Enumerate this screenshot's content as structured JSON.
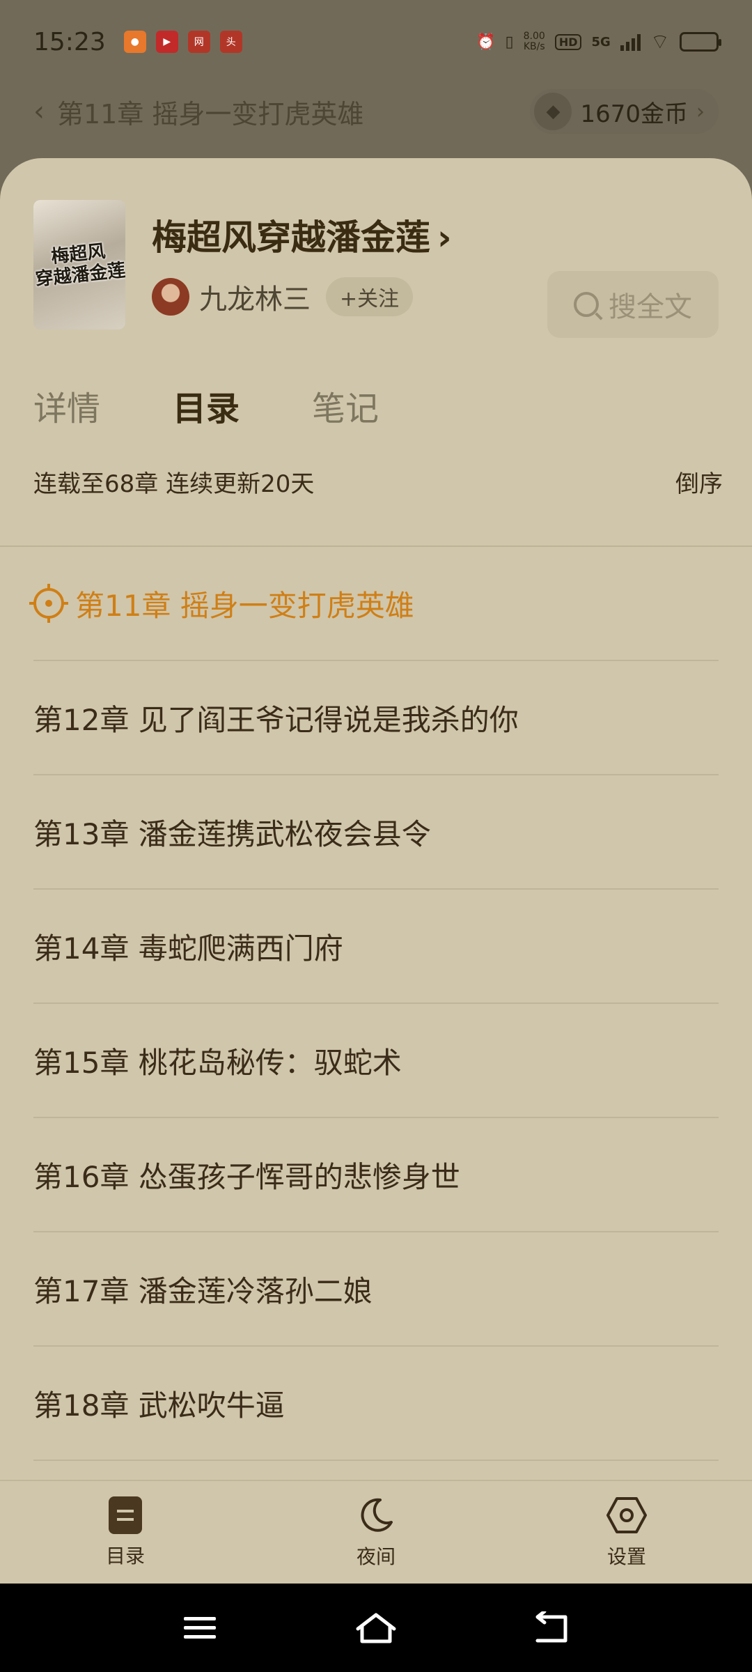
{
  "status_bar": {
    "time": "15:23",
    "notification_icons": [
      "app-icon-orange",
      "app-icon-red-play",
      "app-icon-netease",
      "app-icon-toutiao"
    ],
    "network_speed_value": "8.00",
    "network_speed_unit": "KB/s",
    "hd_label": "HD",
    "network_type": "5G",
    "battery_color": "#e3b22a"
  },
  "reader_header": {
    "chapter_title": "第11章 摇身一变打虎英雄",
    "coins": "1670金币"
  },
  "book": {
    "cover_text": "梅超风穿越潘金莲",
    "title": "梅超风穿越潘金莲",
    "author": "九龙林三",
    "follow_label": "+关注",
    "search_label": "搜全文"
  },
  "tabs": [
    {
      "label": "详情",
      "active": false
    },
    {
      "label": "目录",
      "active": true
    },
    {
      "label": "笔记",
      "active": false
    }
  ],
  "catalog": {
    "summary": "连载至68章 连续更新20天",
    "sort_label": "倒序",
    "accent_color": "#cf7f16",
    "chapters": [
      {
        "title": "第11章 摇身一变打虎英雄",
        "current": true
      },
      {
        "title": "第12章 见了阎王爷记得说是我杀的你",
        "current": false
      },
      {
        "title": "第13章 潘金莲携武松夜会县令",
        "current": false
      },
      {
        "title": "第14章 毒蛇爬满西门府",
        "current": false
      },
      {
        "title": "第15章 桃花岛秘传：驭蛇术",
        "current": false
      },
      {
        "title": "第16章 怂蛋孩子恽哥的悲惨身世",
        "current": false
      },
      {
        "title": "第17章 潘金莲冷落孙二娘",
        "current": false
      },
      {
        "title": "第18章 武松吹牛逼",
        "current": false
      }
    ]
  },
  "bottom_bar": {
    "toc_label": "目录",
    "night_label": "夜间",
    "settings_label": "设置"
  }
}
